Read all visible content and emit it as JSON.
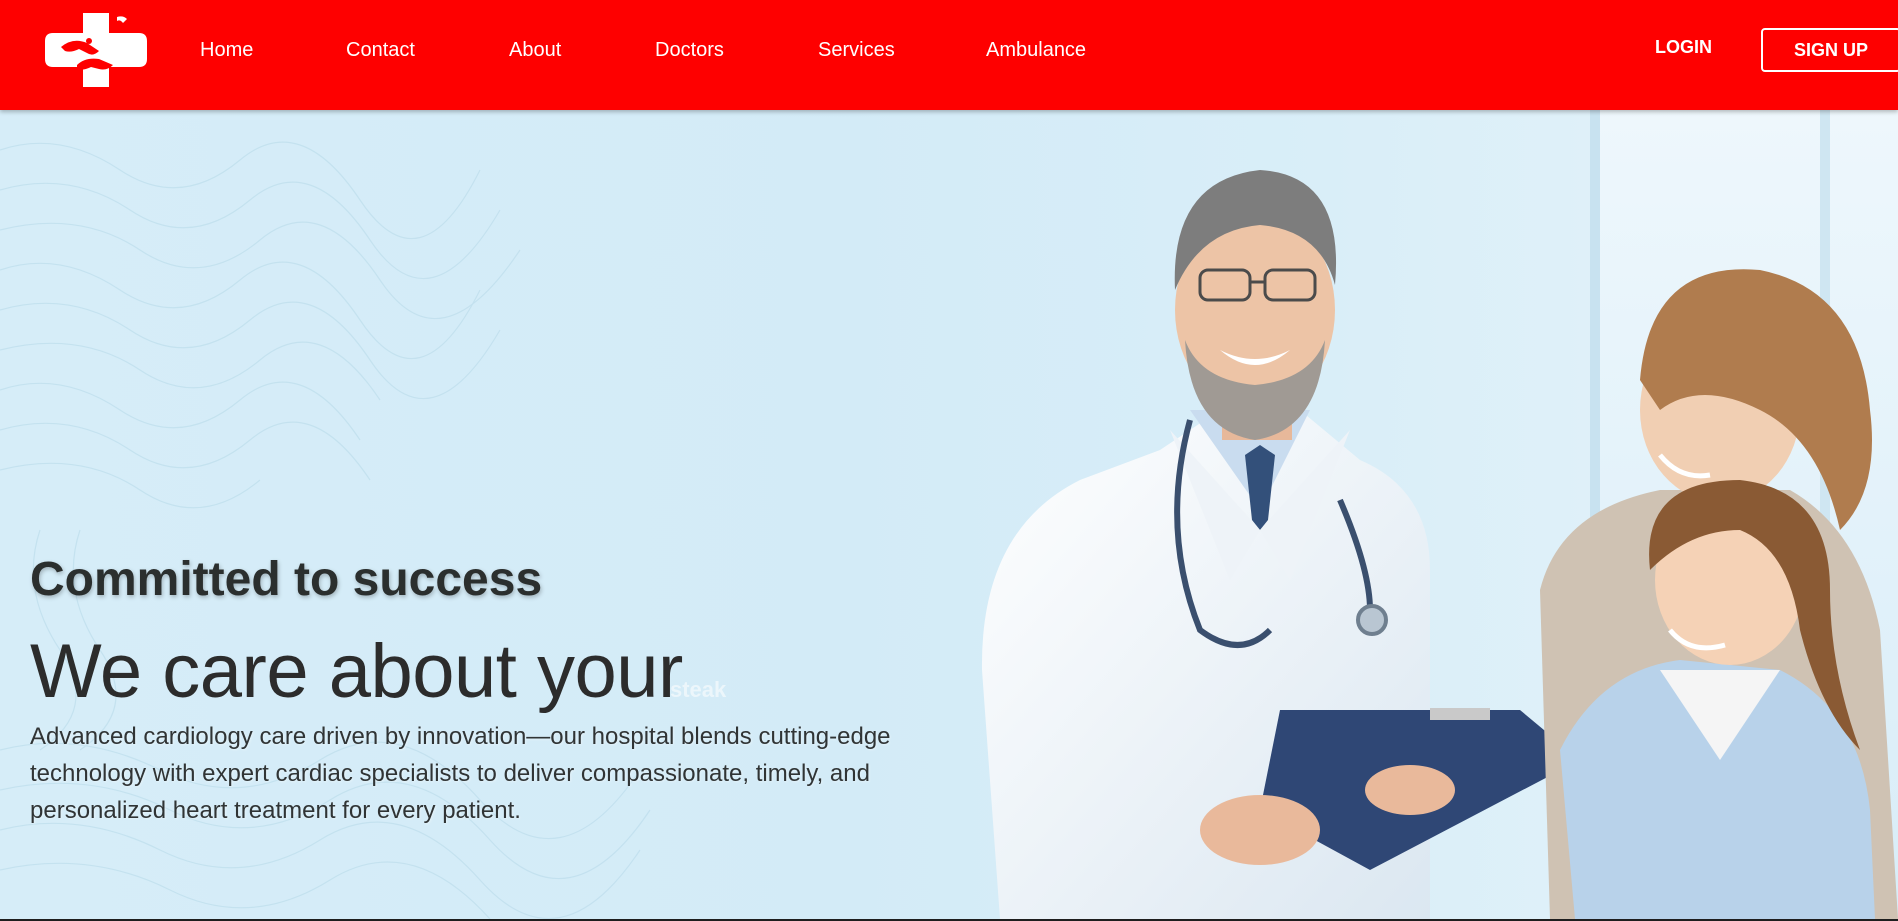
{
  "brand": {
    "logo_icon": "medical-cross-hands-icon",
    "colors": {
      "nav_background": "#fe0000",
      "text_on_nav": "#ffffff",
      "hero_background": "#d6edf8"
    }
  },
  "nav": {
    "links": [
      "Home",
      "Contact",
      "About",
      "Doctors",
      "Services",
      "Ambulance"
    ],
    "login_label": "LOGIN",
    "signup_label": "SIGN UP"
  },
  "hero": {
    "subtitle": "Committed to success",
    "headline": "We care about your",
    "ghost_word": "steak",
    "description": "Advanced cardiology care driven by innovation—our hospital blends cutting-edge technology with expert cardiac specialists to deliver compassionate, timely, and personalized heart treatment for every patient.",
    "image": "doctor-with-clipboard-and-mother-with-daughter-photo"
  }
}
